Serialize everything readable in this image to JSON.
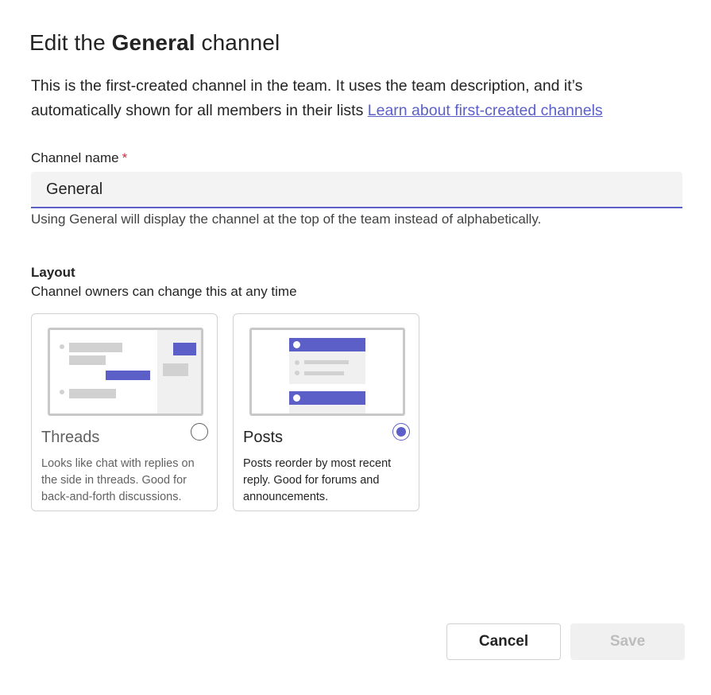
{
  "dialog": {
    "title_prefix": "Edit the ",
    "title_bold": "General",
    "title_suffix": " channel",
    "description": "This is the first-created channel in the team. It uses the team description, and it’s automatically shown for all members in their lists ",
    "learn_link": "Learn about first-created channels"
  },
  "channel_name": {
    "label": "Channel name",
    "required_mark": "*",
    "value": "General",
    "hint": "Using General will display the channel at the top of the team instead of alphabetically."
  },
  "layout": {
    "title": "Layout",
    "subtitle": "Channel owners can change this at any time",
    "selected": "posts",
    "options": [
      {
        "id": "threads",
        "title": "Threads",
        "description": "Looks like chat with replies on the side in threads. Good for back-and-forth discussions.",
        "checked": false
      },
      {
        "id": "posts",
        "title": "Posts",
        "description": "Posts reorder by most recent reply. Good for forums and announcements.",
        "checked": true
      }
    ]
  },
  "footer": {
    "cancel_label": "Cancel",
    "save_label": "Save"
  },
  "colors": {
    "accent": "#5b5fc7",
    "required": "#c4314b",
    "disabled_bg": "#f0f0f0"
  }
}
